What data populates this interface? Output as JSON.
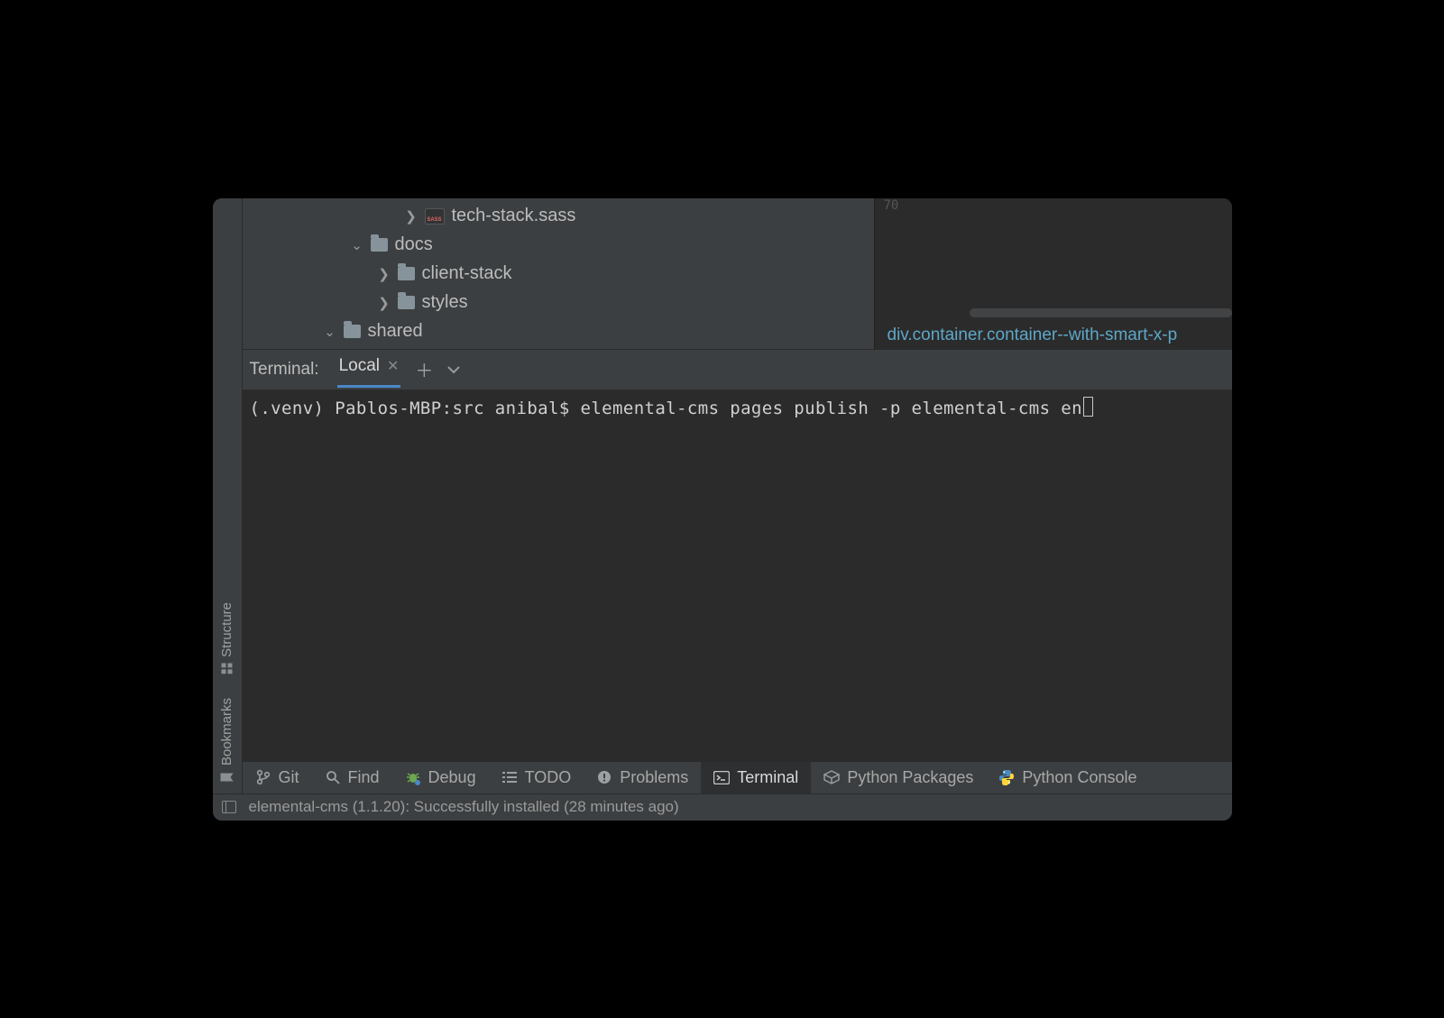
{
  "left_gutter": {
    "structure": "Structure",
    "bookmarks": "Bookmarks"
  },
  "tree": {
    "tech_stack": "tech-stack.sass",
    "docs": "docs",
    "client_stack": "client-stack",
    "styles": "styles",
    "shared": "shared"
  },
  "editor": {
    "line_num": "70",
    "breadcrumb": "div.container.container--with-smart-x-p"
  },
  "terminal": {
    "panel_label": "Terminal:",
    "tab_label": "Local",
    "command_line": "(.venv) Pablos-MBP:src anibal$ elemental-cms pages publish -p elemental-cms en"
  },
  "bottom_tabs": {
    "git": "Git",
    "find": "Find",
    "debug": "Debug",
    "todo": "TODO",
    "problems": "Problems",
    "terminal": "Terminal",
    "python_packages": "Python Packages",
    "python_console": "Python Console"
  },
  "status": {
    "message": "elemental-cms (1.1.20): Successfully installed (28 minutes ago)"
  }
}
